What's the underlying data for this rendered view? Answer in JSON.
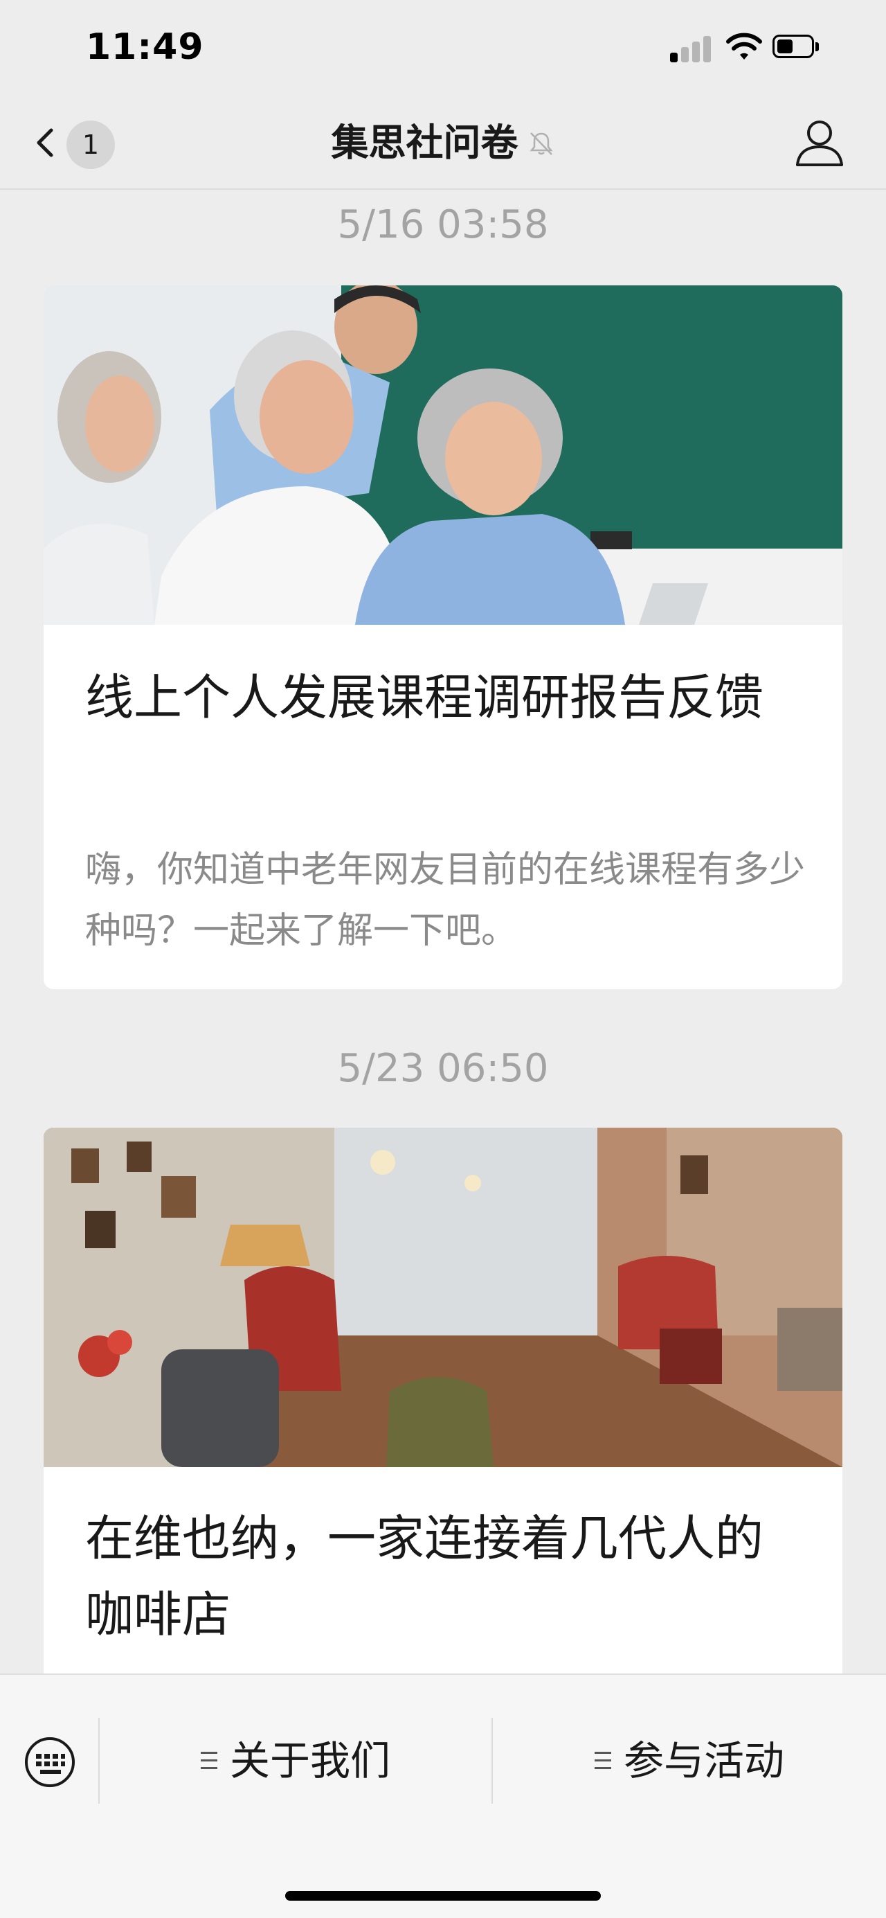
{
  "status_bar": {
    "time": "11:49"
  },
  "nav": {
    "title": "集思社问卷",
    "unread_count": "1"
  },
  "feed": [
    {
      "timestamp": "5/16 03:58",
      "title": "线上个人发展课程调研报告反馈",
      "description": "嗨，你知道中老年网友目前的在线课程有多少种吗？一起来了解一下吧。"
    },
    {
      "timestamp": "5/23 06:50",
      "title": "在维也纳，一家连接着几代人的咖啡店",
      "description": ""
    }
  ],
  "bottom_menu": {
    "items": [
      {
        "label": "关于我们"
      },
      {
        "label": "参与活动"
      }
    ]
  },
  "colors": {
    "background": "#ededed",
    "card": "#ffffff",
    "timestamp": "#a3a3a3",
    "description": "#8a8a8a"
  }
}
